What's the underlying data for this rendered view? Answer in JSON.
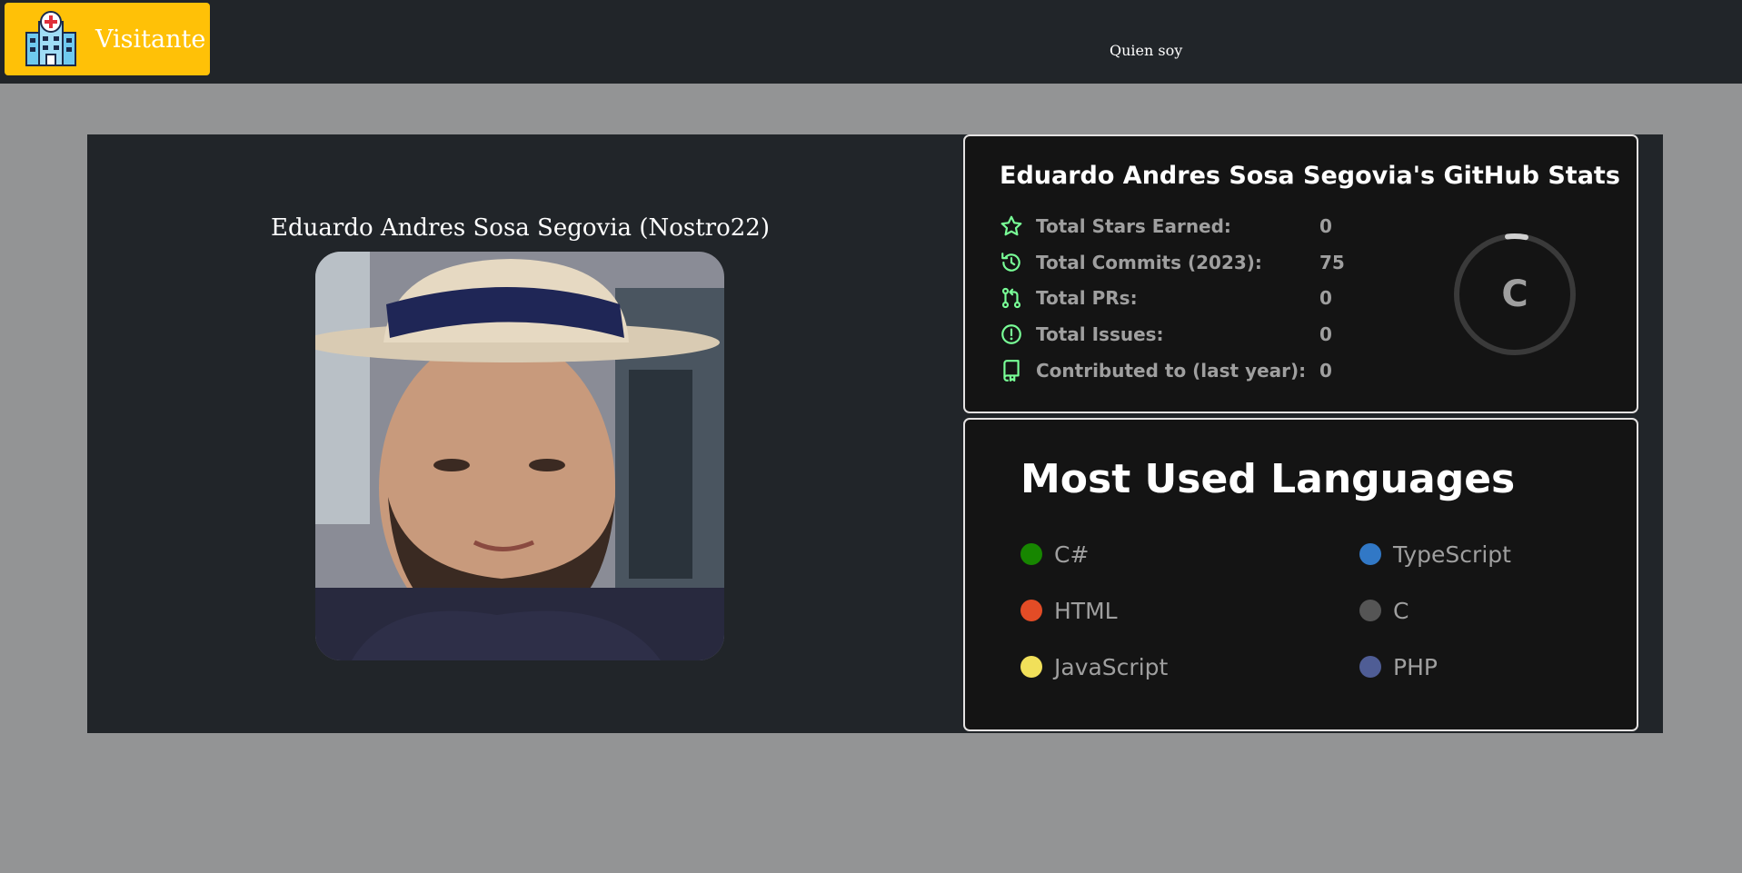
{
  "navbar": {
    "brand_text": "Visitante",
    "brand_icon": "hospital-icon",
    "link_quien_soy": "Quien soy"
  },
  "profile": {
    "name": "Eduardo Andres Sosa Segovia (Nostro22)",
    "photo": "profile-photo"
  },
  "github_stats": {
    "title": "Eduardo Andres Sosa Segovia's GitHub Stats",
    "rank": "C",
    "accent_color": "#79ff97",
    "rows": [
      {
        "label": "Total Stars Earned:",
        "value": "0",
        "icon": "star-icon"
      },
      {
        "label": "Total Commits (2023):",
        "value": "75",
        "icon": "history-icon"
      },
      {
        "label": "Total PRs:",
        "value": "0",
        "icon": "pull-request-icon"
      },
      {
        "label": "Total Issues:",
        "value": "0",
        "icon": "issue-icon"
      },
      {
        "label": "Contributed to (last year):",
        "value": "0",
        "icon": "repo-icon"
      }
    ]
  },
  "languages": {
    "title": "Most Used Languages",
    "items": [
      {
        "name": "C#",
        "color": "#178600"
      },
      {
        "name": "TypeScript",
        "color": "#3178c6"
      },
      {
        "name": "HTML",
        "color": "#e34c26"
      },
      {
        "name": "C",
        "color": "#555555"
      },
      {
        "name": "JavaScript",
        "color": "#f1e05a"
      },
      {
        "name": "PHP",
        "color": "#4F5D95"
      }
    ]
  },
  "colors": {
    "navbar_bg": "#212529",
    "brand_bg": "#ffc107",
    "page_bg": "#939495",
    "card_bg": "#141414"
  }
}
